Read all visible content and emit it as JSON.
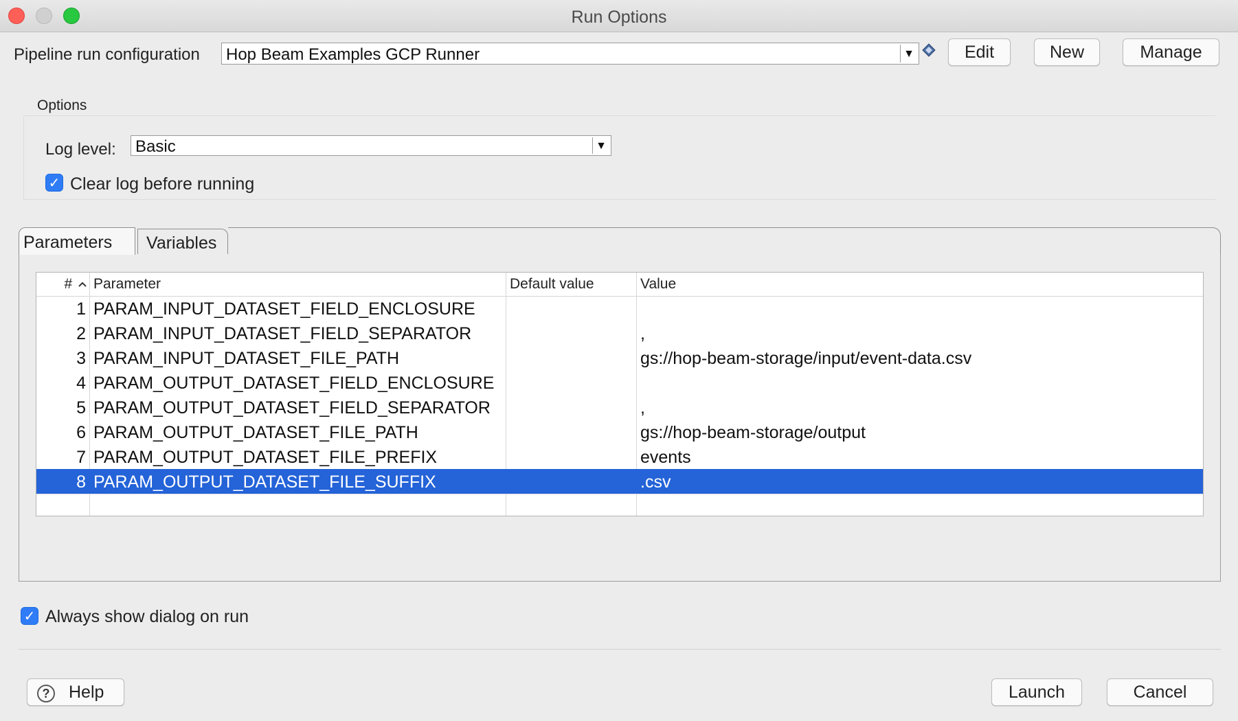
{
  "window": {
    "title": "Run Options"
  },
  "run_config": {
    "label": "Pipeline run configuration",
    "value": "Hop Beam Examples GCP Runner",
    "edit_label": "Edit",
    "new_label": "New",
    "manage_label": "Manage"
  },
  "options": {
    "group_label": "Options",
    "log_level_label": "Log level:",
    "log_level_value": "Basic",
    "clear_log_label": "Clear log before running",
    "clear_log_checked": true
  },
  "tabs": [
    {
      "label": "Parameters",
      "active": true
    },
    {
      "label": "Variables",
      "active": false
    }
  ],
  "table": {
    "columns": [
      "#",
      "Parameter",
      "Default value",
      "Value"
    ],
    "rows": [
      {
        "num": "1",
        "parameter": "PARAM_INPUT_DATASET_FIELD_ENCLOSURE",
        "default": "",
        "value": ""
      },
      {
        "num": "2",
        "parameter": "PARAM_INPUT_DATASET_FIELD_SEPARATOR",
        "default": "",
        "value": ","
      },
      {
        "num": "3",
        "parameter": "PARAM_INPUT_DATASET_FILE_PATH",
        "default": "",
        "value": "gs://hop-beam-storage/input/event-data.csv"
      },
      {
        "num": "4",
        "parameter": "PARAM_OUTPUT_DATASET_FIELD_ENCLOSURE",
        "default": "",
        "value": ""
      },
      {
        "num": "5",
        "parameter": "PARAM_OUTPUT_DATASET_FIELD_SEPARATOR",
        "default": "",
        "value": ","
      },
      {
        "num": "6",
        "parameter": "PARAM_OUTPUT_DATASET_FILE_PATH",
        "default": "",
        "value": "gs://hop-beam-storage/output"
      },
      {
        "num": "7",
        "parameter": "PARAM_OUTPUT_DATASET_FILE_PREFIX",
        "default": "",
        "value": "events"
      },
      {
        "num": "8",
        "parameter": "PARAM_OUTPUT_DATASET_FILE_SUFFIX",
        "default": "",
        "value": ".csv"
      }
    ],
    "selected_row": 8
  },
  "always_show": {
    "label": "Always show dialog on run",
    "checked": true
  },
  "footer": {
    "help_label": "Help",
    "launch_label": "Launch",
    "cancel_label": "Cancel"
  },
  "icons": {
    "sort_indicator": "chevron-up-icon",
    "help": "question-circle-icon",
    "variable": "diamond-icon",
    "check": "checkmark-icon"
  },
  "colors": {
    "selection": "#2463d8",
    "checkbox": "#2f7cf6",
    "close": "#fe5f57",
    "maximize": "#28c840"
  }
}
